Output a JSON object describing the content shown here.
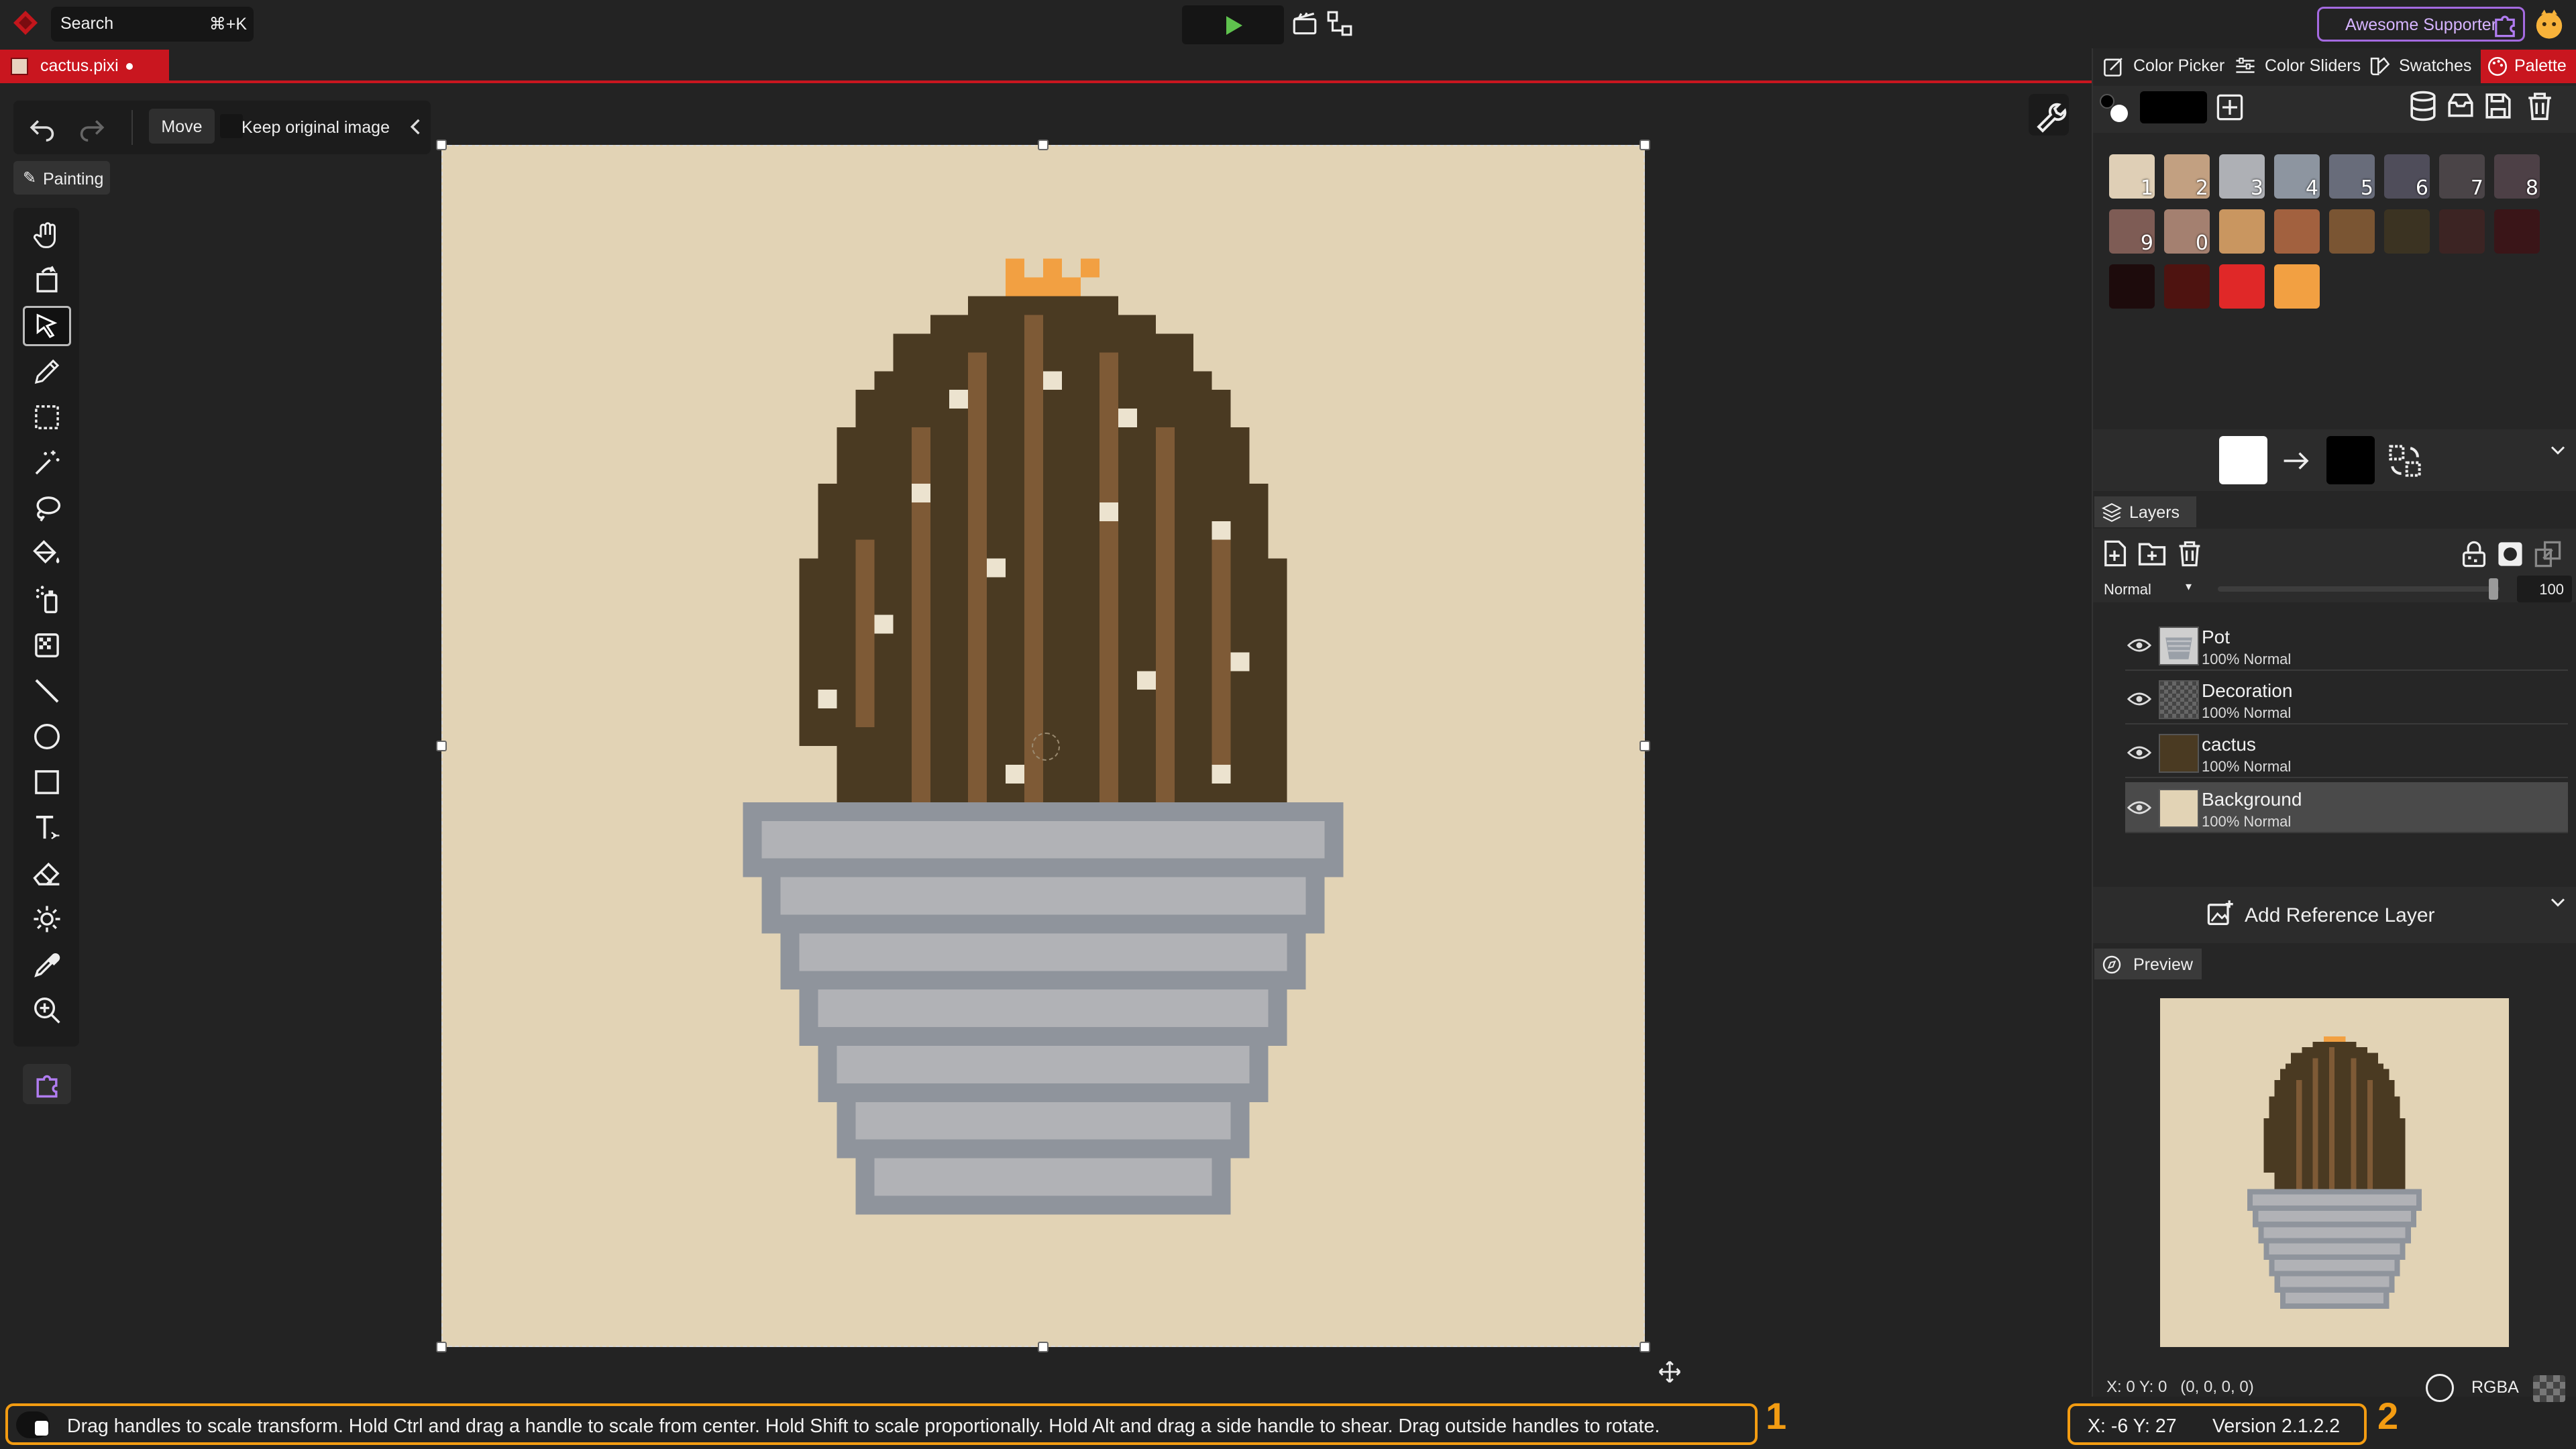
{
  "app": {
    "accent": "#d4202f",
    "tab_title": "cactus.pixi"
  },
  "search": {
    "label": "Search",
    "shortcut": "⌘+K"
  },
  "topbar": {
    "supporter_label": "Awesome Supporter"
  },
  "toolbar": {
    "mode_label": "Move",
    "keep_original_label": "Keep original image",
    "keep_original_checked": false
  },
  "tool_group": {
    "label": "Painting"
  },
  "tools": [
    "hand-icon",
    "rotate-canvas-icon",
    "move-selection-icon",
    "pencil-icon",
    "rectangle-select-icon",
    "magic-wand-icon",
    "lasso-icon",
    "paint-bucket-icon",
    "spray-icon",
    "dither-icon",
    "line-icon",
    "ellipse-icon",
    "rectangle-icon",
    "text-icon",
    "eraser-icon",
    "brightness-icon",
    "color-picker-icon",
    "zoom-icon"
  ],
  "right_tabs": [
    "Color Picker",
    "Color Sliders",
    "Swatches",
    "Palette"
  ],
  "palette": {
    "colors": [
      "#dfcfb6",
      "#c2a081",
      "#aeb0b5",
      "#8d95a0",
      "#686c7a",
      "#4f4d5a",
      "#4a4447",
      "#4d4046",
      "#7e5c55",
      "#a48070",
      "#c99660",
      "#a2613f",
      "#7a5533",
      "#3b3322",
      "#3c2423",
      "#3a1518",
      "#1d0b0c",
      "#4e1310",
      "#e02828",
      "#f2a042"
    ],
    "numbers": [
      "1",
      "2",
      "3",
      "4",
      "5",
      "6",
      "7",
      "8",
      "9",
      "0"
    ]
  },
  "colors": {
    "primary": "#ffffff",
    "secondary": "#000000"
  },
  "layers_panel": {
    "title": "Layers",
    "blend_mode": "Normal",
    "opacity": "100",
    "layers": [
      {
        "name": "Pot",
        "meta": "100%  Normal"
      },
      {
        "name": "Decoration",
        "meta": "100%  Normal"
      },
      {
        "name": "cactus",
        "meta": "100%  Normal"
      },
      {
        "name": "Background",
        "meta": "100%  Normal"
      }
    ],
    "add_reference_label": "Add Reference Layer"
  },
  "preview": {
    "title": "Preview"
  },
  "statusbar": {
    "pixel_info": "X: 0 Y: 0   (0, 0, 0, 0)",
    "color_mode": "RGBA",
    "hint": "Drag handles to scale transform. Hold Ctrl and drag a handle to scale from center. Hold Shift to scale proportionally. Hold Alt and drag a side handle to shear. Drag outside handles to rotate.",
    "coords": "X: -6 Y: 27",
    "version": "Version 2.1.2.2",
    "callout_1": "1",
    "callout_2": "2"
  }
}
